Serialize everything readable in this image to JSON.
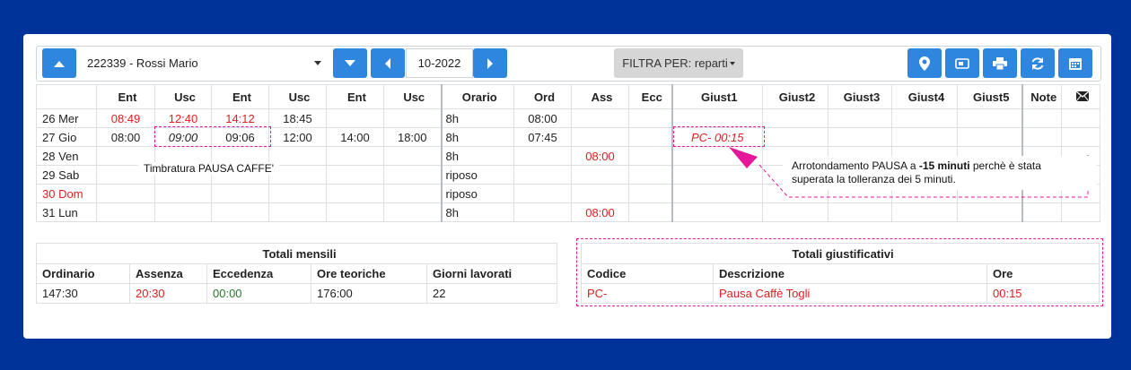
{
  "toolbar": {
    "employee": "222339 - Rossi Mario",
    "month": "10-2022",
    "filter_label": "FILTRA PER: reparti"
  },
  "grid": {
    "headers": [
      "",
      "Ent",
      "Usc",
      "Ent",
      "Usc",
      "Ent",
      "Usc",
      "Orario",
      "Ord",
      "Ass",
      "Ecc",
      "Giust1",
      "Giust2",
      "Giust3",
      "Giust4",
      "Giust5",
      "Note"
    ],
    "rows": [
      {
        "day": "26 Mer",
        "ent1": "08:49",
        "usc1": "12:40",
        "ent2": "14:12",
        "usc2": "18:45",
        "ent3": "",
        "usc3": "",
        "orario": "8h",
        "ord": "08:00",
        "ass": "",
        "ecc": "",
        "giust1": ""
      },
      {
        "day": "27 Gio",
        "ent1": "08:00",
        "usc1": "09:00",
        "ent2": "09:06",
        "usc2": "12:00",
        "ent3": "14:00",
        "usc3": "18:00",
        "orario": "8h",
        "ord": "07:45",
        "ass": "",
        "ecc": "",
        "giust1": "PC- 00:15"
      },
      {
        "day": "28 Ven",
        "ent1": "",
        "usc1": "",
        "ent2": "",
        "usc2": "",
        "ent3": "",
        "usc3": "",
        "orario": "8h",
        "ord": "",
        "ass": "08:00",
        "ecc": "",
        "giust1": ""
      },
      {
        "day": "29 Sab",
        "ent1": "",
        "usc1": "",
        "ent2": "",
        "usc2": "",
        "ent3": "",
        "usc3": "",
        "orario": "riposo",
        "ord": "",
        "ass": "",
        "ecc": "",
        "giust1": ""
      },
      {
        "day": "30 Dom",
        "ent1": "",
        "usc1": "",
        "ent2": "",
        "usc2": "",
        "ent3": "",
        "usc3": "",
        "orario": "riposo",
        "ord": "",
        "ass": "",
        "ecc": "",
        "giust1": ""
      },
      {
        "day": "31 Lun",
        "ent1": "",
        "usc1": "",
        "ent2": "",
        "usc2": "",
        "ent3": "",
        "usc3": "",
        "orario": "8h",
        "ord": "",
        "ass": "08:00",
        "ecc": "",
        "giust1": ""
      }
    ]
  },
  "annotations": {
    "pausa_label": "Timbratura PAUSA CAFFE'",
    "rounding_line1_pre": "Arrotondamento PAUSA a ",
    "rounding_line1_bold": "-15 minuti",
    "rounding_line1_post": " perchè è stata",
    "rounding_line2": "superata la tolleranza dei 5 minuti."
  },
  "totali_mensili": {
    "title": "Totali mensili",
    "headers": [
      "Ordinario",
      "Assenza",
      "Eccedenza",
      "Ore teoriche",
      "Giorni lavorati"
    ],
    "values": [
      "147:30",
      "20:30",
      "00:00",
      "176:00",
      "22"
    ]
  },
  "totali_giustificativi": {
    "title": "Totali giustificativi",
    "headers": [
      "Codice",
      "Descrizione",
      "Ore"
    ],
    "values": [
      "PC-",
      "Pausa Caffè Togli",
      "00:15"
    ]
  },
  "colors": {
    "accent": "#2e86de",
    "background": "#003399",
    "highlight": "#e6189a",
    "red": "#e02020"
  },
  "icons": [
    "chevron-up-icon",
    "chevron-down-icon",
    "chevron-left-icon",
    "chevron-right-icon",
    "map-marker-icon",
    "id-card-icon",
    "print-icon",
    "refresh-icon",
    "calendar-icon",
    "envelope-icon"
  ]
}
